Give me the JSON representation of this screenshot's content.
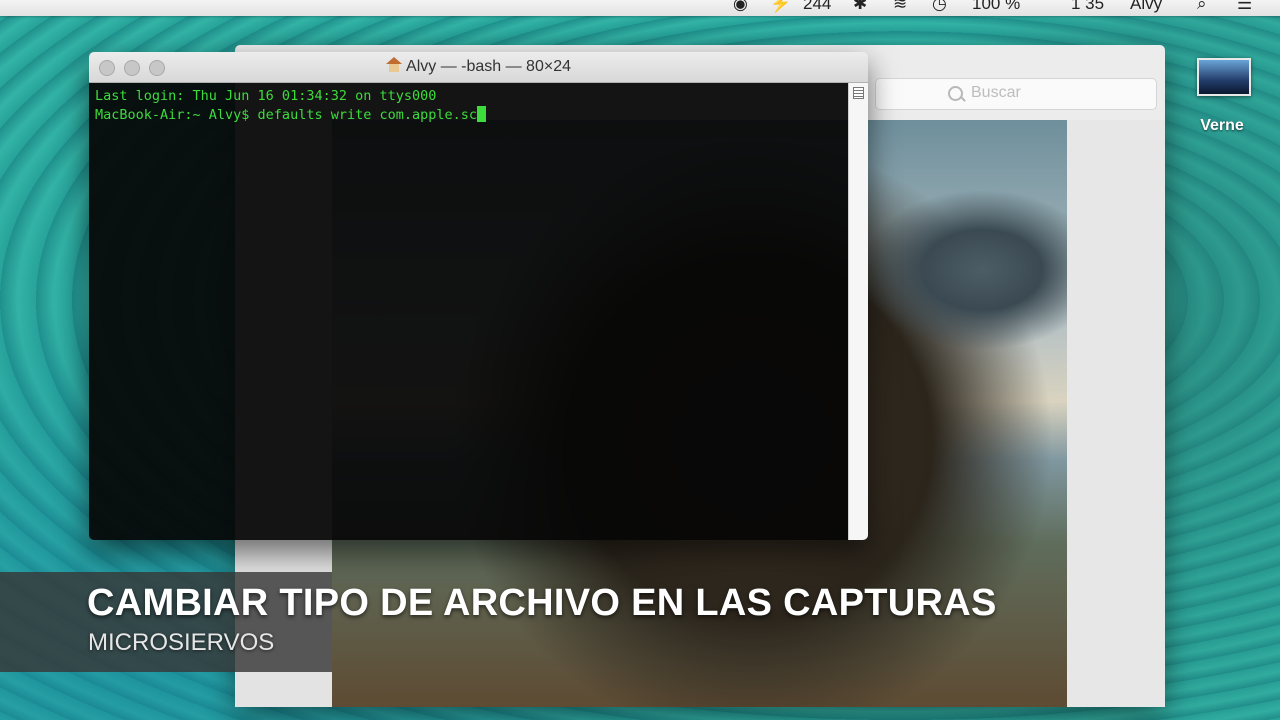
{
  "menubar": {
    "items": [
      "◉",
      "⚡",
      "244",
      "✱",
      "≋",
      "◷",
      "100 %",
      "1 35",
      "Alvy",
      "⌕",
      "☰"
    ]
  },
  "desktop": {
    "icon_label": "Verne"
  },
  "finder": {
    "search_placeholder": "Buscar"
  },
  "terminal": {
    "title": "Alvy — -bash — 80×24",
    "lines": [
      "Last login: Thu Jun 16 01:34:32 on ttys000",
      "MacBook-Air:~ Alvy$ defaults write com.apple.sc"
    ]
  },
  "caption": {
    "title": "CAMBIAR TIPO DE ARCHIVO EN LAS CAPTURAS",
    "subtitle": "MICROSIERVOS"
  },
  "colors": {
    "terminal_text": "#3ddc3d",
    "desktop_teal": "#2a9d93"
  }
}
